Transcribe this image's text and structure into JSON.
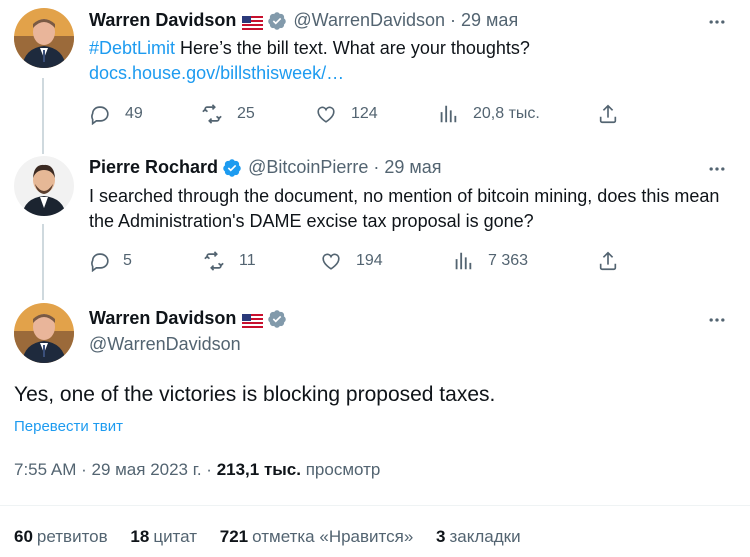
{
  "tweet1": {
    "name": "Warren Davidson",
    "handle": "@WarrenDavidson",
    "dot": "·",
    "date": "29 мая",
    "hashtag": "#DebtLimit",
    "text": " Here’s the bill text. What are your thoughts?",
    "link": "docs.house.gov/billsthisweek/…",
    "replies": "49",
    "retweets": "25",
    "likes": "124",
    "views": "20,8 тыс."
  },
  "tweet2": {
    "name": "Pierre Rochard",
    "handle": "@BitcoinPierre",
    "dot": "·",
    "date": "29 мая",
    "text": "I searched through the document, no mention of bitcoin mining, does this mean the Administration's DAME excise tax proposal is gone?",
    "replies": "5",
    "retweets": "11",
    "likes": "194",
    "views": "7 363"
  },
  "main_tweet": {
    "name": "Warren Davidson",
    "handle": "@WarrenDavidson",
    "text": "Yes, one of the victories is blocking proposed taxes.",
    "translate": "Перевести твит",
    "time": "7:55 AM",
    "date": "29 мая 2023 г.",
    "views_count": "213,1 тыс.",
    "views_label": "просмотр",
    "stats": {
      "retweets_count": "60",
      "retweets_label": "ретвитов",
      "quotes_count": "18",
      "quotes_label": "цитат",
      "likes_count": "721",
      "likes_label": "отметка «Нравится»",
      "bookmarks_count": "3",
      "bookmarks_label": "закладки"
    }
  },
  "colors": {
    "accent": "#1d9bf0",
    "secondary_text": "#536471",
    "verified_gray": "#829aab",
    "verified_blue": "#1d9bf0"
  },
  "icons": [
    "reply-icon",
    "retweet-icon",
    "like-icon",
    "views-icon",
    "share-icon",
    "more-icon",
    "verified-badge-icon",
    "us-flag-icon"
  ]
}
